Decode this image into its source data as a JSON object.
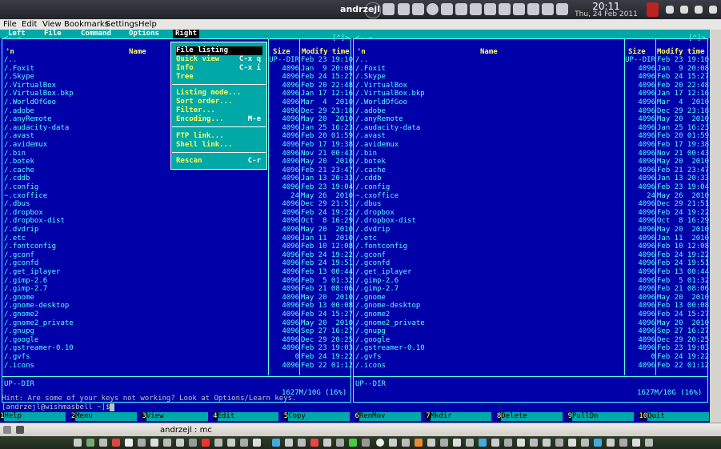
{
  "window_title": "andrzejl",
  "clock": {
    "time": "20:11",
    "date": "Thu, 24 Feb 2011"
  },
  "app_menu": [
    "File",
    "Edit",
    "View",
    "Bookmarks",
    "Settings",
    "Help"
  ],
  "mc_menu": [
    "Left",
    "File",
    "Command",
    "Options",
    "Right"
  ],
  "left_panel": {
    "head_left": "<- ~",
    "head_right": "[^]>",
    "columns": {
      "name": "Name"
    },
    "sort_marker": "'n",
    "status": "UP--DIR",
    "free_space": "1627M/10G (16%)",
    "rows": [
      {
        "name": "/..",
        "size": "UP--DIR",
        "date": "Feb 23 19:10"
      },
      {
        "name": "/.Foxit",
        "size": "4096",
        "date": "Jan  9 20:08"
      },
      {
        "name": "/.Skype",
        "size": "4096",
        "date": "Feb 24 15:27"
      },
      {
        "name": "/.VirtualBox",
        "size": "4096",
        "date": "Feb 20 22:48"
      },
      {
        "name": "/.VirtualBox.bkp",
        "size": "4096",
        "date": "Jan 17 12:16"
      },
      {
        "name": "/.WorldOfGoo",
        "size": "4096",
        "date": "Mar  4  2010"
      },
      {
        "name": "/.adobe",
        "size": "4096",
        "date": "Dec 29 23:18"
      },
      {
        "name": "/.anyRemote",
        "size": "4096",
        "date": "May 20  2010"
      },
      {
        "name": "/.audacity-data",
        "size": "4096",
        "date": "Jan 25 16:23"
      },
      {
        "name": "/.avast",
        "size": "4096",
        "date": "Feb 20 01:59"
      },
      {
        "name": "/.avidemux",
        "size": "4096",
        "date": "Feb 17 19:38"
      },
      {
        "name": "/.bin",
        "size": "4096",
        "date": "Nov 21 00:43"
      },
      {
        "name": "/.botek",
        "size": "4096",
        "date": "May 20  2010"
      },
      {
        "name": "/.cache",
        "size": "4096",
        "date": "Feb 21 23:47"
      },
      {
        "name": "/.cddb",
        "size": "4096",
        "date": "Jan 13 20:33"
      },
      {
        "name": "/.config",
        "size": "4096",
        "date": "Feb 23 19:04"
      },
      {
        "name": "~.cxoffice",
        "size": "24",
        "date": "May 26  2010"
      },
      {
        "name": "/.dbus",
        "size": "4096",
        "date": "Dec 29 21:51"
      },
      {
        "name": "/.dropbox",
        "size": "4096",
        "date": "Feb 24 19:22"
      },
      {
        "name": "/.dropbox-dist",
        "size": "4096",
        "date": "Oct  8 16:29"
      },
      {
        "name": "/.dvdrip",
        "size": "4096",
        "date": "May 20  2010"
      },
      {
        "name": "/.etc",
        "size": "4096",
        "date": "Jan 11  2010"
      },
      {
        "name": "/.fontconfig",
        "size": "4096",
        "date": "Feb 10 12:08"
      },
      {
        "name": "/.gconf",
        "size": "4096",
        "date": "Feb 24 19:22"
      },
      {
        "name": "/.gconfd",
        "size": "4096",
        "date": "Feb 24 19:51"
      },
      {
        "name": "/.get_iplayer",
        "size": "4096",
        "date": "Feb 13 00:44"
      },
      {
        "name": "/.gimp-2.6",
        "size": "4096",
        "date": "Feb  5 01:32"
      },
      {
        "name": "/.gimp-2.7",
        "size": "4096",
        "date": "Feb 21 08:06"
      },
      {
        "name": "/.gnome",
        "size": "4096",
        "date": "May 20  2010"
      },
      {
        "name": "/.gnome-desktop",
        "size": "4096",
        "date": "Feb 13 00:08"
      },
      {
        "name": "/.gnome2",
        "size": "4096",
        "date": "Feb 24 15:27"
      },
      {
        "name": "/.gnome2_private",
        "size": "4096",
        "date": "May 20  2010"
      },
      {
        "name": "/.gnupg",
        "size": "4096",
        "date": "Sep 27 16:27"
      },
      {
        "name": "/.google",
        "size": "4096",
        "date": "Dec 29 20:25"
      },
      {
        "name": "/.gstreamer-0.10",
        "size": "4096",
        "date": "Feb 23 19:03"
      },
      {
        "name": "/.gvfs",
        "size": "0",
        "date": "Feb 24 19:22"
      },
      {
        "name": "/.icons",
        "size": "4096",
        "date": "Feb 22 01:12"
      }
    ]
  },
  "right_panel": {
    "head_left": "<- ~",
    "head_right": "[^]>",
    "columns": {
      "name": "Name",
      "size": "Size",
      "date": "Modify time"
    },
    "sort_marker": "'n",
    "status": "UP--DIR",
    "free_space": "1627M/10G (16%)"
  },
  "left_columns_right": {
    "size": "Size",
    "date": "Modify time"
  },
  "dropdown": {
    "items": [
      {
        "label": "File listing",
        "key": ""
      },
      {
        "label": "Quick view",
        "key": "C-x q"
      },
      {
        "label": "Info",
        "key": "C-x i"
      },
      {
        "label": "Tree",
        "key": ""
      },
      {
        "label": "Listing mode...",
        "key": ""
      },
      {
        "label": "Sort order...",
        "key": ""
      },
      {
        "label": "Filter...",
        "key": ""
      },
      {
        "label": "Encoding...",
        "key": "M-e"
      },
      {
        "label": "FTP link...",
        "key": ""
      },
      {
        "label": "Shell link...",
        "key": ""
      },
      {
        "label": "Rescan",
        "key": "C-r"
      }
    ]
  },
  "hint": "Hint: Are some of your keys not working? Look at Options/Learn keys.",
  "prompt": "[andrzejl@wishmasbell ~]$",
  "fkeys": [
    {
      "num": "1",
      "label": "Help"
    },
    {
      "num": "2",
      "label": "Menu"
    },
    {
      "num": "3",
      "label": "View"
    },
    {
      "num": "4",
      "label": "Edit"
    },
    {
      "num": "5",
      "label": "Copy"
    },
    {
      "num": "6",
      "label": "RenMov"
    },
    {
      "num": "7",
      "label": "Mkdir"
    },
    {
      "num": "8",
      "label": "Delete"
    },
    {
      "num": "9",
      "label": "PullDn"
    },
    {
      "num": "10",
      "label": "Quit"
    }
  ],
  "taskbar_label": "andrzejl : mc",
  "colors": {
    "mc_blue": "#0000a8",
    "mc_cyan": "#00a8a8",
    "mc_text": "#55ffff",
    "mc_yellow": "#ffff55"
  }
}
